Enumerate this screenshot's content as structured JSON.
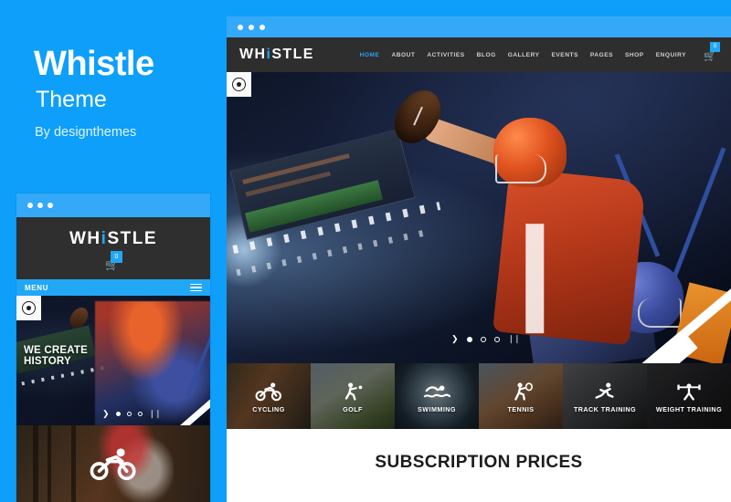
{
  "promo": {
    "title": "Whistle",
    "subtitle": "Theme",
    "byline": "By designthemes",
    "background_color": "#0d9ffa"
  },
  "mobile_preview": {
    "titlebar_dots": 3,
    "logo": {
      "before": "WH",
      "accent": "i",
      "after": "STLE"
    },
    "cart": {
      "icon": "cart-icon",
      "badge_count": "0"
    },
    "menu_bar": {
      "label": "MENU",
      "icon": "hamburger-icon"
    },
    "badge_icon": "soccer-ball-icon",
    "hero": {
      "caption_line1": "WE CREATE",
      "caption_line2": "HISTORY",
      "controls": {
        "prev_arrow": "❯",
        "dots": 3,
        "active_dot_index": 0,
        "pause": "❘❘"
      }
    },
    "bottom_card": {
      "icon": "cycling-icon"
    }
  },
  "browser": {
    "titlebar_dots": 3,
    "header": {
      "logo": {
        "before": "WH",
        "accent": "i",
        "after": "STLE"
      },
      "nav_items": [
        {
          "label": "HOME",
          "active": true
        },
        {
          "label": "ABOUT",
          "active": false
        },
        {
          "label": "ACTIVITIES",
          "active": false
        },
        {
          "label": "BLOG",
          "active": false
        },
        {
          "label": "GALLERY",
          "active": false
        },
        {
          "label": "EVENTS",
          "active": false
        },
        {
          "label": "PAGES",
          "active": false
        },
        {
          "label": "SHOP",
          "active": false
        },
        {
          "label": "ENQUIRY",
          "active": false
        }
      ],
      "cart": {
        "icon": "cart-icon",
        "badge_count": "0"
      }
    },
    "hero": {
      "badge_icon": "soccer-ball-icon",
      "controls": {
        "prev_arrow": "❯",
        "dots": 3,
        "active_dot_index": 0,
        "pause": "❘❘"
      }
    },
    "activities": [
      {
        "label": "CYCLING",
        "icon": "cycling-icon",
        "bg": "bg-cycling"
      },
      {
        "label": "GOLF",
        "icon": "golf-icon",
        "bg": "bg-golf"
      },
      {
        "label": "SWIMMING",
        "icon": "swimming-icon",
        "bg": "bg-swimming"
      },
      {
        "label": "TENNIS",
        "icon": "tennis-icon",
        "bg": "bg-tennis"
      },
      {
        "label": "TRACK TRAINING",
        "icon": "running-icon",
        "bg": "bg-track"
      },
      {
        "label": "WEIGHT TRAINING",
        "icon": "weightlifting-icon",
        "bg": "bg-weight"
      }
    ],
    "subscription": {
      "title": "SUBSCRIPTION PRICES"
    }
  },
  "colors": {
    "brand_blue": "#0d9ffa",
    "titlebar_blue": "#33a9f8",
    "accent_blue": "#22a7f5",
    "header_dark": "#2e2e2e"
  }
}
